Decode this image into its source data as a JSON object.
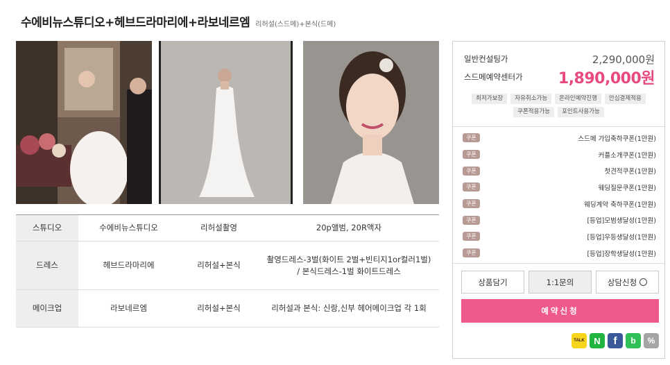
{
  "header": {
    "title": "수에비뉴스튜디오+헤브드라마리에+라보네르엠",
    "subtitle": "리허설(스드메)+본식(드메)"
  },
  "photos": [
    {
      "alt": "wedding-couple-photo"
    },
    {
      "alt": "bride-gown-photo"
    },
    {
      "alt": "bride-portrait-photo"
    }
  ],
  "info_table": {
    "rows": [
      {
        "category": "스튜디오",
        "vendor": "수에비뉴스튜디오",
        "type": "리허설촬영",
        "detail": "20p앨범, 20R액자"
      },
      {
        "category": "드레스",
        "vendor": "헤브드라마리에",
        "type": "리허설+본식",
        "detail": "촬영드레스-3벌(화이트 2벌+빈티지1or컬러1벌) / 본식드레스-1벌 화이트드레스"
      },
      {
        "category": "메이크업",
        "vendor": "라보네르엠",
        "type": "리허설+본식",
        "detail": "리허설과 본식: 신랑,신부 헤어메이크업 각 1회"
      }
    ]
  },
  "pricing": {
    "general_label": "일반컨설팅가",
    "general_price": "2,290,000원",
    "sdm_label": "스드메예약센터가",
    "sdm_price": "1,890,000원"
  },
  "tags": [
    "최저가보장",
    "자유취소가능",
    "온라인예약진행",
    "안심결제적용",
    "쿠폰적용가능",
    "포인트사용가능"
  ],
  "coupons": [
    {
      "badge": "쿠폰",
      "name": "스드메 가입축하쿠폰(1만원)"
    },
    {
      "badge": "쿠폰",
      "name": "커플소개쿠폰(1만원)"
    },
    {
      "badge": "쿠폰",
      "name": "첫견적쿠폰(1만원)"
    },
    {
      "badge": "쿠폰",
      "name": "웨딩질문쿠폰(1만원)"
    },
    {
      "badge": "쿠폰",
      "name": "웨딩계약 축하쿠폰(1만원)"
    },
    {
      "badge": "쿠폰",
      "name": "[등업]모범생달성(1만원)"
    },
    {
      "badge": "쿠폰",
      "name": "[등업]우등생달성(1만원)"
    },
    {
      "badge": "쿠폰",
      "name": "[등업]장학생달성(1만원)"
    }
  ],
  "buttons": {
    "wishlist": "상품담기",
    "inquiry": "1:1문의",
    "consult": "상담신청",
    "reserve": "예약신청"
  },
  "share": {
    "kakaotalk": "TALK",
    "naver": "N",
    "facebook": "f",
    "band": "b",
    "link": "%"
  },
  "colors": {
    "accent": "#ef5a8a",
    "price": "#e84a7f",
    "coupon_badge": "#b89a94"
  }
}
